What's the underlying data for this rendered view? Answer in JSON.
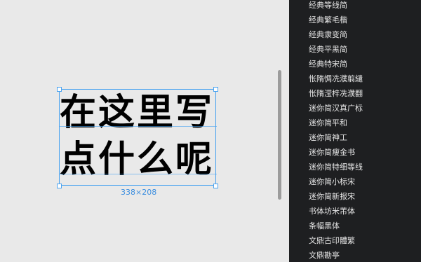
{
  "canvas": {
    "text_lines": [
      "在这里写",
      "点什么呢"
    ],
    "dimension_label": "338×208"
  },
  "font_list": [
    "经典等线简",
    "经典繁毛楷",
    "经典隶变简",
    "经典平黑简",
    "经典特宋简",
    "怅隋惆冼濮翦繾",
    "怅隋滢梓冼濮翻",
    "迷你简汉真广标",
    "迷你简平和",
    "迷你简神工",
    "迷你简瘦金书",
    "迷你简特细等线",
    "迷你简小标宋",
    "迷你简新报宋",
    "书体坊米芾体",
    "条幅黑体",
    "文鼎古印體繁",
    "文鼎勘亭"
  ]
}
